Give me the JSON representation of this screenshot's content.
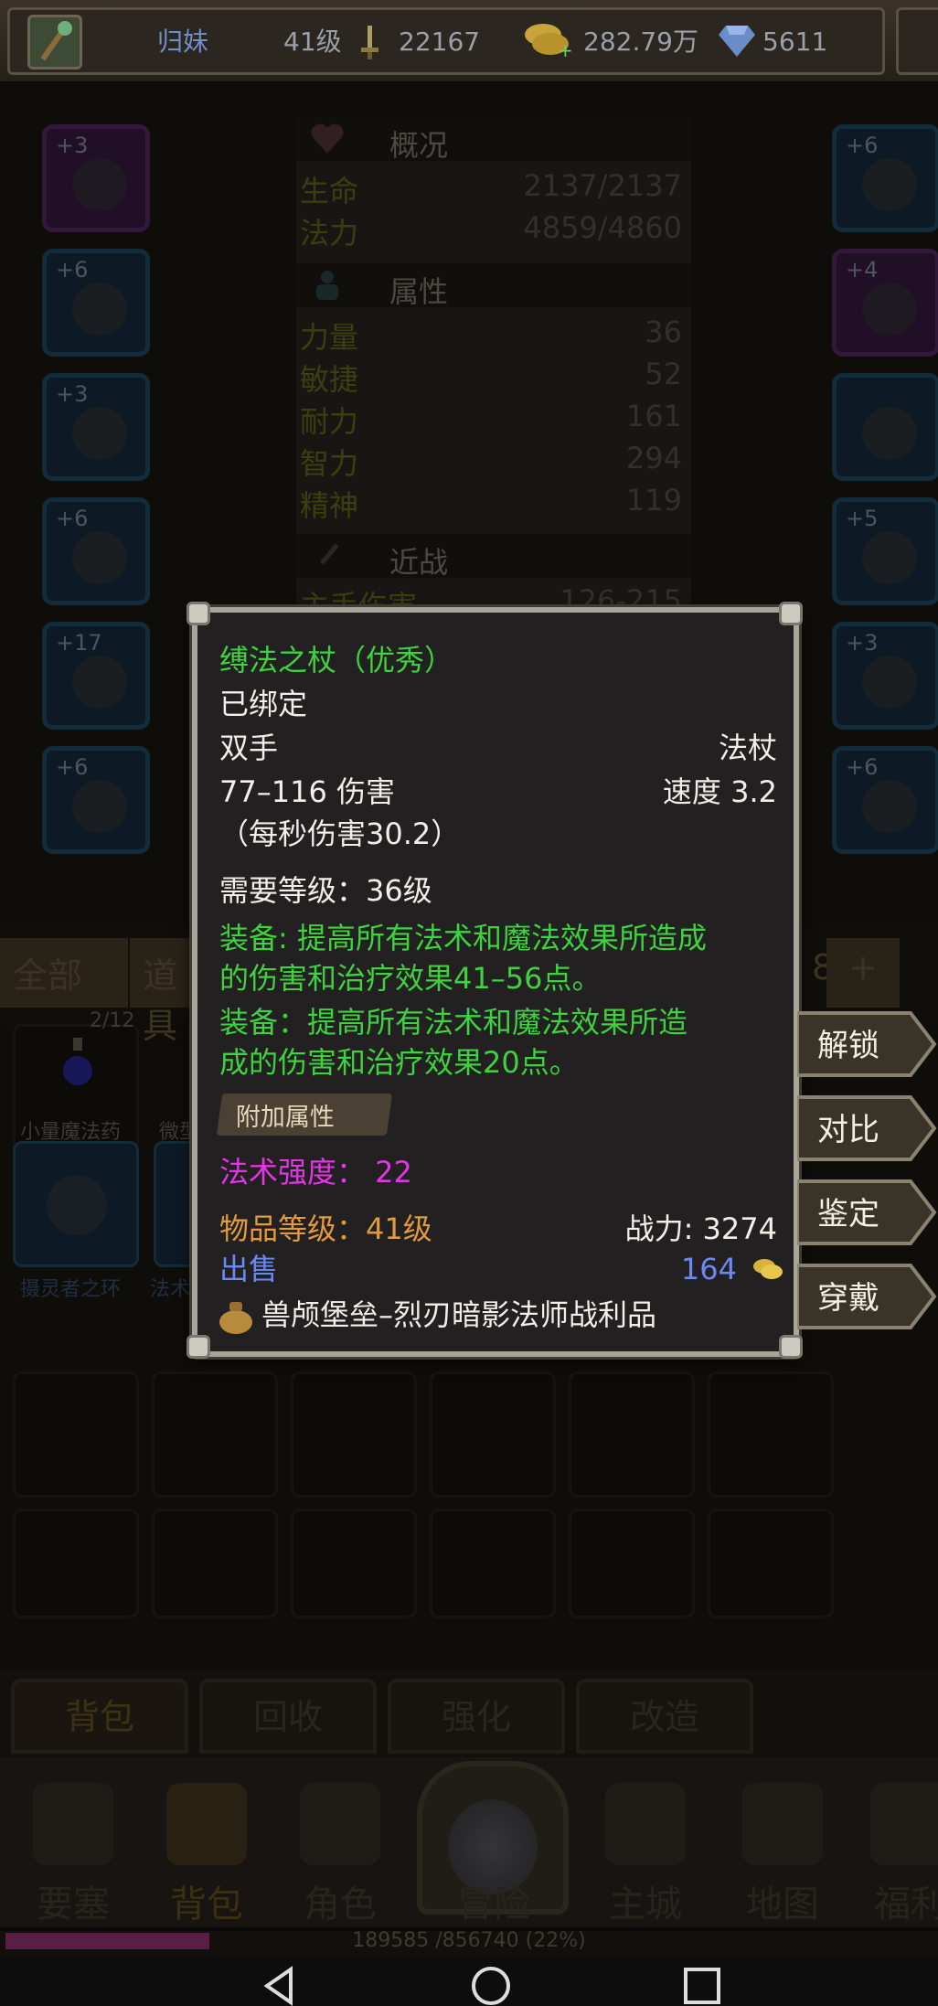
{
  "topbar": {
    "name": "归妹",
    "level": "41级",
    "power": "22167",
    "gold": "282.79万",
    "gems": "5611"
  },
  "stats": {
    "overview_title": "概况",
    "hp_label": "生命",
    "hp_value": "2137/2137",
    "mp_label": "法力",
    "mp_value": "4859/4860",
    "attr_title": "属性",
    "attrs": [
      {
        "label": "力量",
        "value": "36"
      },
      {
        "label": "敏捷",
        "value": "52"
      },
      {
        "label": "耐力",
        "value": "161"
      },
      {
        "label": "智力",
        "value": "294"
      },
      {
        "label": "精神",
        "value": "119"
      }
    ],
    "melee_title": "近战",
    "melee_row_partial": "主手伤害",
    "melee_row_value": "126-215"
  },
  "left_slots": [
    "+3",
    "+6",
    "+3",
    "+6",
    "+17",
    "+6"
  ],
  "right_slots": [
    "+6",
    "+4",
    "",
    "+5",
    "+3",
    "+6"
  ],
  "filter": {
    "all": "全部",
    "items_partial": "道具",
    "page_partial": "8",
    "add": "+"
  },
  "bag_items": [
    {
      "label": "小量魔法药",
      "count": "2/12"
    },
    {
      "label": "微型"
    },
    {
      "label": "摄灵者之环"
    },
    {
      "label": "法术"
    }
  ],
  "tooltip": {
    "name": "缚法之杖（优秀）",
    "bound": "已绑定",
    "hand": "双手",
    "type": "法杖",
    "damage": "77–116 伤害",
    "speed": "速度 3.2",
    "dps": "（每秒伤害30.2）",
    "req_level": "需要等级：36级",
    "equip1_line1": "装备: 提高所有法术和魔法效果所造成",
    "equip1_line2": "的伤害和治疗效果41–56点。",
    "equip2_line1": "装备：提高所有法术和魔法效果所造",
    "equip2_line2": "成的伤害和治疗效果20点。",
    "extra_header": "附加属性",
    "spell_power": "法术强度： 22",
    "item_level": "物品等级：41级",
    "combat_power": "战力: 3274",
    "sell_label": "出售",
    "sell_price": "164",
    "source": "兽颅堡垒–烈刃暗影法师战利品"
  },
  "actions": [
    "解锁",
    "对比",
    "鉴定",
    "穿戴"
  ],
  "bottom_tabs": [
    "背包",
    "回收",
    "强化",
    "改造"
  ],
  "nav": [
    "要塞",
    "背包",
    "角色",
    "冒险",
    "主城",
    "地图",
    "福利"
  ],
  "exp": "189585 /856740 (22%)",
  "exp_fraction": 0.22,
  "colors": {
    "quality_green": "#3fd23f",
    "spell_magenta": "#e235e8",
    "item_level_orange": "#e19a3c",
    "sell_blue": "#6b88f4",
    "tooltip_bg": "#222021"
  }
}
